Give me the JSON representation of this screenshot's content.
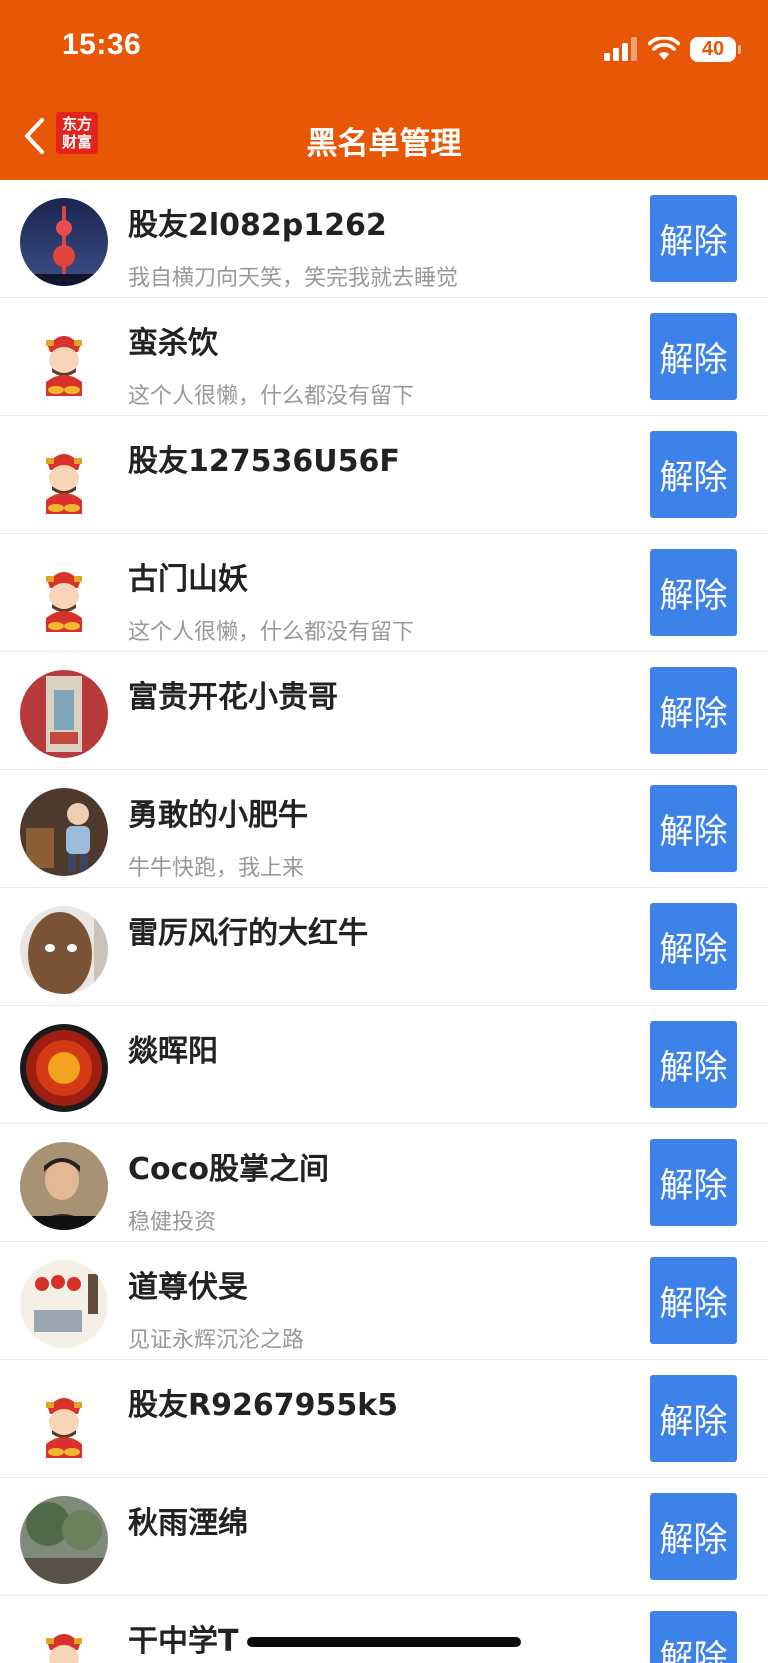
{
  "status_bar": {
    "time": "15:36",
    "battery": "40"
  },
  "nav": {
    "title": "黑名单管理",
    "logo_line1": "东方",
    "logo_line2": "财富"
  },
  "colors": {
    "header": "#e85706",
    "button": "#3d82e8",
    "logo": "#e4231c"
  },
  "unblock_label": "解除",
  "rows": [
    {
      "name": "股友2l082p1262",
      "bio": "我自横刀向天笑，笑完我就去睡觉",
      "avatar": "tower-photo-avatar"
    },
    {
      "name": "蛮杀饮",
      "bio": "这个人很懒，什么都没有留下",
      "avatar": "fortune-god-avatar"
    },
    {
      "name": "股友127536U56F",
      "bio": "",
      "avatar": "fortune-god-avatar"
    },
    {
      "name": "古门山妖",
      "bio": "这个人很懒，什么都没有留下",
      "avatar": "fortune-god-avatar"
    },
    {
      "name": "富贵开花小贵哥",
      "bio": "",
      "avatar": "painting-avatar"
    },
    {
      "name": "勇敢的小肥牛",
      "bio": "牛牛快跑，我上来",
      "avatar": "child-photo-avatar"
    },
    {
      "name": "雷厉风行的大红牛",
      "bio": "",
      "avatar": "face-photo-avatar"
    },
    {
      "name": "燚晖阳",
      "bio": "",
      "avatar": "sun-avatar"
    },
    {
      "name": "Coco股掌之间",
      "bio": "稳健投资",
      "avatar": "man-photo-avatar"
    },
    {
      "name": "道尊伏旻",
      "bio": "见证永辉沉沦之路",
      "avatar": "lantern-painting-avatar"
    },
    {
      "name": "股友R9267955k5",
      "bio": "",
      "avatar": "fortune-god-avatar"
    },
    {
      "name": "秋雨湮绵",
      "bio": "",
      "avatar": "garden-photo-avatar"
    },
    {
      "name": "干中学T",
      "bio": "",
      "avatar": "fortune-god-avatar"
    }
  ]
}
